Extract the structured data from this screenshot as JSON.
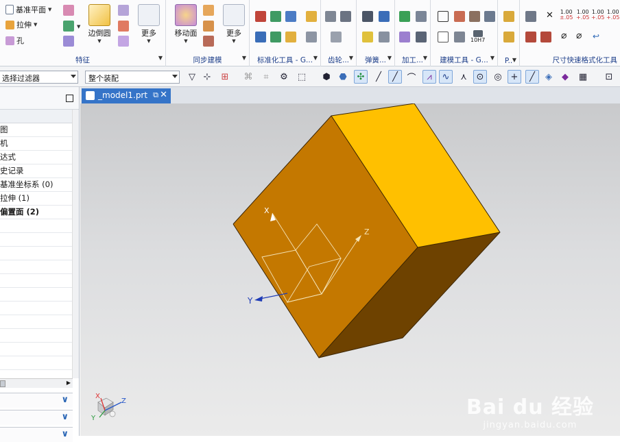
{
  "ribbon": {
    "feature": {
      "datum_plane": "基准平面",
      "extrude": "拉伸",
      "hole": "孔",
      "edge_blend": "边倒圆",
      "more": "更多",
      "group_label": "特征"
    },
    "sync": {
      "move_face": "移动面",
      "more": "更多",
      "group_label": "同步建模"
    },
    "groups": {
      "standard_tools": "标准化工具 - G...",
      "gear": "齿轮...",
      "spring": "弹簧...",
      "machining": "加工...",
      "building_tools": "建模工具 - G...",
      "dim_quick": "尺寸快速格式化工具"
    },
    "dim_labels": {
      "d1": "1.00",
      "d2": "1.00",
      "d3": "1.00",
      "d4": "1.00",
      "tol": "10H7"
    }
  },
  "toolbar2": {
    "filter_value": "选择过滤器",
    "scope_value": "整个装配"
  },
  "navigator": {
    "rows": [
      {
        "label": "图"
      },
      {
        "label": "机"
      },
      {
        "label": "达式"
      },
      {
        "label": "史记录"
      },
      {
        "label": "基准坐标系 (0)"
      },
      {
        "label": "拉伸 (1)"
      },
      {
        "label": "偏置面 (2)",
        "bold": true
      }
    ]
  },
  "tab": {
    "filename": "_model1.prt"
  },
  "viewport": {
    "axis_x": "X",
    "axis_y": "Y",
    "axis_z": "Z",
    "triad_x": "X",
    "triad_y": "Y",
    "triad_z": "Z",
    "colors": {
      "front_face": "#C47800",
      "top_face": "#FFC000",
      "side_face": "#6E4200",
      "background": "#D9DADC",
      "accent": "#3574C8"
    }
  },
  "watermark": {
    "main": "Bai du 经验",
    "sub": "jingyan.baidu.com"
  }
}
